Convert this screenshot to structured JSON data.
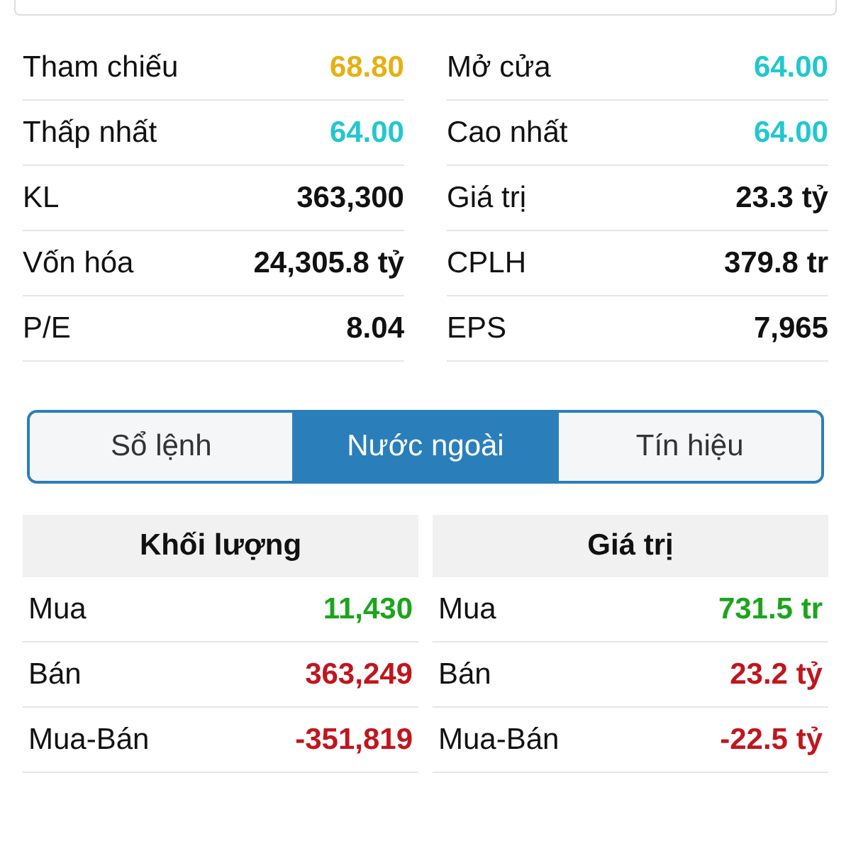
{
  "stats": [
    {
      "label": "Tham chiếu",
      "value": "68.80",
      "color": "#e6b012"
    },
    {
      "label": "Mở cửa",
      "value": "64.00",
      "color": "#22c7cf"
    },
    {
      "label": "Thấp nhất",
      "value": "64.00",
      "color": "#22c7cf"
    },
    {
      "label": "Cao nhất",
      "value": "64.00",
      "color": "#22c7cf"
    },
    {
      "label": "KL",
      "value": "363,300",
      "color": "#111111"
    },
    {
      "label": "Giá trị",
      "value": "23.3 tỷ",
      "color": "#111111"
    },
    {
      "label": "Vốn hóa",
      "value": "24,305.8 tỷ",
      "color": "#111111"
    },
    {
      "label": "CPLH",
      "value": "379.8 tr",
      "color": "#111111"
    },
    {
      "label": "P/E",
      "value": "8.04",
      "color": "#111111"
    },
    {
      "label": "EPS",
      "value": "7,965",
      "color": "#111111"
    }
  ],
  "tabs": [
    {
      "label": "Sổ lệnh",
      "selected": false
    },
    {
      "label": "Nước ngoài",
      "selected": true
    },
    {
      "label": "Tín hiệu",
      "selected": false
    }
  ],
  "foreign_tables": [
    {
      "title": "Khối lượng",
      "rows": [
        {
          "label": "Mua",
          "value": "11,430",
          "color": "#1ca51c"
        },
        {
          "label": "Bán",
          "value": "363,249",
          "color": "#c0161e"
        },
        {
          "label": "Mua-Bán",
          "value": "-351,819",
          "color": "#c0161e"
        }
      ]
    },
    {
      "title": "Giá trị",
      "rows": [
        {
          "label": "Mua",
          "value": "731.5 tr",
          "color": "#1ca51c"
        },
        {
          "label": "Bán",
          "value": "23.2 tỷ",
          "color": "#c0161e"
        },
        {
          "label": "Mua-Bán",
          "value": "-22.5 tỷ",
          "color": "#c0161e"
        }
      ]
    }
  ]
}
